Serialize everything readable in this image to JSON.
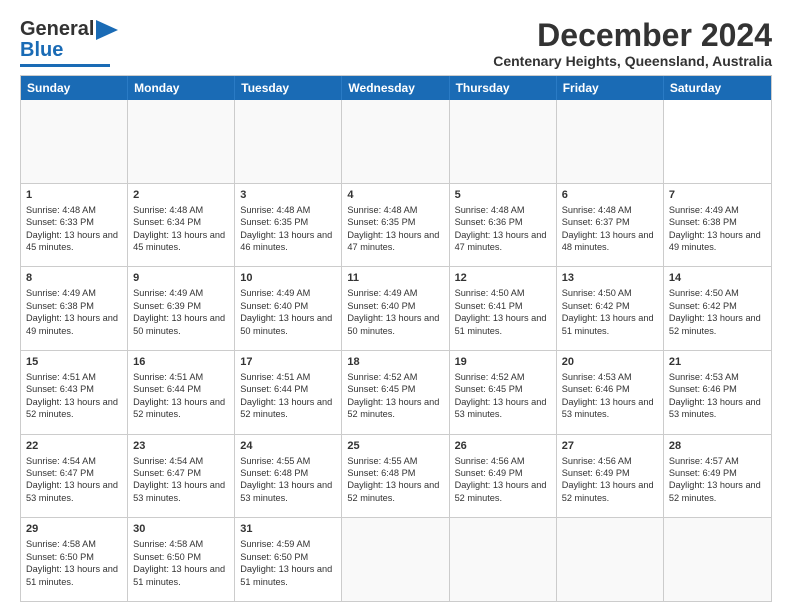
{
  "header": {
    "logo_general": "General",
    "logo_blue": "Blue",
    "main_title": "December 2024",
    "subtitle": "Centenary Heights, Queensland, Australia"
  },
  "calendar": {
    "days": [
      "Sunday",
      "Monday",
      "Tuesday",
      "Wednesday",
      "Thursday",
      "Friday",
      "Saturday"
    ],
    "weeks": [
      [
        {
          "day": "",
          "empty": true
        },
        {
          "day": "",
          "empty": true
        },
        {
          "day": "",
          "empty": true
        },
        {
          "day": "",
          "empty": true
        },
        {
          "day": "",
          "empty": true
        },
        {
          "day": "",
          "empty": true
        },
        {
          "day": ""
        }
      ],
      [
        {
          "num": "1",
          "sunrise": "Sunrise: 4:48 AM",
          "sunset": "Sunset: 6:33 PM",
          "daylight": "Daylight: 13 hours and 45 minutes."
        },
        {
          "num": "2",
          "sunrise": "Sunrise: 4:48 AM",
          "sunset": "Sunset: 6:34 PM",
          "daylight": "Daylight: 13 hours and 45 minutes."
        },
        {
          "num": "3",
          "sunrise": "Sunrise: 4:48 AM",
          "sunset": "Sunset: 6:35 PM",
          "daylight": "Daylight: 13 hours and 46 minutes."
        },
        {
          "num": "4",
          "sunrise": "Sunrise: 4:48 AM",
          "sunset": "Sunset: 6:35 PM",
          "daylight": "Daylight: 13 hours and 47 minutes."
        },
        {
          "num": "5",
          "sunrise": "Sunrise: 4:48 AM",
          "sunset": "Sunset: 6:36 PM",
          "daylight": "Daylight: 13 hours and 47 minutes."
        },
        {
          "num": "6",
          "sunrise": "Sunrise: 4:48 AM",
          "sunset": "Sunset: 6:37 PM",
          "daylight": "Daylight: 13 hours and 48 minutes."
        },
        {
          "num": "7",
          "sunrise": "Sunrise: 4:49 AM",
          "sunset": "Sunset: 6:38 PM",
          "daylight": "Daylight: 13 hours and 49 minutes."
        }
      ],
      [
        {
          "num": "8",
          "sunrise": "Sunrise: 4:49 AM",
          "sunset": "Sunset: 6:38 PM",
          "daylight": "Daylight: 13 hours and 49 minutes."
        },
        {
          "num": "9",
          "sunrise": "Sunrise: 4:49 AM",
          "sunset": "Sunset: 6:39 PM",
          "daylight": "Daylight: 13 hours and 50 minutes."
        },
        {
          "num": "10",
          "sunrise": "Sunrise: 4:49 AM",
          "sunset": "Sunset: 6:40 PM",
          "daylight": "Daylight: 13 hours and 50 minutes."
        },
        {
          "num": "11",
          "sunrise": "Sunrise: 4:49 AM",
          "sunset": "Sunset: 6:40 PM",
          "daylight": "Daylight: 13 hours and 50 minutes."
        },
        {
          "num": "12",
          "sunrise": "Sunrise: 4:50 AM",
          "sunset": "Sunset: 6:41 PM",
          "daylight": "Daylight: 13 hours and 51 minutes."
        },
        {
          "num": "13",
          "sunrise": "Sunrise: 4:50 AM",
          "sunset": "Sunset: 6:42 PM",
          "daylight": "Daylight: 13 hours and 51 minutes."
        },
        {
          "num": "14",
          "sunrise": "Sunrise: 4:50 AM",
          "sunset": "Sunset: 6:42 PM",
          "daylight": "Daylight: 13 hours and 52 minutes."
        }
      ],
      [
        {
          "num": "15",
          "sunrise": "Sunrise: 4:51 AM",
          "sunset": "Sunset: 6:43 PM",
          "daylight": "Daylight: 13 hours and 52 minutes."
        },
        {
          "num": "16",
          "sunrise": "Sunrise: 4:51 AM",
          "sunset": "Sunset: 6:44 PM",
          "daylight": "Daylight: 13 hours and 52 minutes."
        },
        {
          "num": "17",
          "sunrise": "Sunrise: 4:51 AM",
          "sunset": "Sunset: 6:44 PM",
          "daylight": "Daylight: 13 hours and 52 minutes."
        },
        {
          "num": "18",
          "sunrise": "Sunrise: 4:52 AM",
          "sunset": "Sunset: 6:45 PM",
          "daylight": "Daylight: 13 hours and 52 minutes."
        },
        {
          "num": "19",
          "sunrise": "Sunrise: 4:52 AM",
          "sunset": "Sunset: 6:45 PM",
          "daylight": "Daylight: 13 hours and 53 minutes."
        },
        {
          "num": "20",
          "sunrise": "Sunrise: 4:53 AM",
          "sunset": "Sunset: 6:46 PM",
          "daylight": "Daylight: 13 hours and 53 minutes."
        },
        {
          "num": "21",
          "sunrise": "Sunrise: 4:53 AM",
          "sunset": "Sunset: 6:46 PM",
          "daylight": "Daylight: 13 hours and 53 minutes."
        }
      ],
      [
        {
          "num": "22",
          "sunrise": "Sunrise: 4:54 AM",
          "sunset": "Sunset: 6:47 PM",
          "daylight": "Daylight: 13 hours and 53 minutes."
        },
        {
          "num": "23",
          "sunrise": "Sunrise: 4:54 AM",
          "sunset": "Sunset: 6:47 PM",
          "daylight": "Daylight: 13 hours and 53 minutes."
        },
        {
          "num": "24",
          "sunrise": "Sunrise: 4:55 AM",
          "sunset": "Sunset: 6:48 PM",
          "daylight": "Daylight: 13 hours and 53 minutes."
        },
        {
          "num": "25",
          "sunrise": "Sunrise: 4:55 AM",
          "sunset": "Sunset: 6:48 PM",
          "daylight": "Daylight: 13 hours and 52 minutes."
        },
        {
          "num": "26",
          "sunrise": "Sunrise: 4:56 AM",
          "sunset": "Sunset: 6:49 PM",
          "daylight": "Daylight: 13 hours and 52 minutes."
        },
        {
          "num": "27",
          "sunrise": "Sunrise: 4:56 AM",
          "sunset": "Sunset: 6:49 PM",
          "daylight": "Daylight: 13 hours and 52 minutes."
        },
        {
          "num": "28",
          "sunrise": "Sunrise: 4:57 AM",
          "sunset": "Sunset: 6:49 PM",
          "daylight": "Daylight: 13 hours and 52 minutes."
        }
      ],
      [
        {
          "num": "29",
          "sunrise": "Sunrise: 4:58 AM",
          "sunset": "Sunset: 6:50 PM",
          "daylight": "Daylight: 13 hours and 51 minutes."
        },
        {
          "num": "30",
          "sunrise": "Sunrise: 4:58 AM",
          "sunset": "Sunset: 6:50 PM",
          "daylight": "Daylight: 13 hours and 51 minutes."
        },
        {
          "num": "31",
          "sunrise": "Sunrise: 4:59 AM",
          "sunset": "Sunset: 6:50 PM",
          "daylight": "Daylight: 13 hours and 51 minutes."
        },
        {
          "day": "",
          "empty": true
        },
        {
          "day": "",
          "empty": true
        },
        {
          "day": "",
          "empty": true
        },
        {
          "day": "",
          "empty": true
        }
      ]
    ]
  }
}
